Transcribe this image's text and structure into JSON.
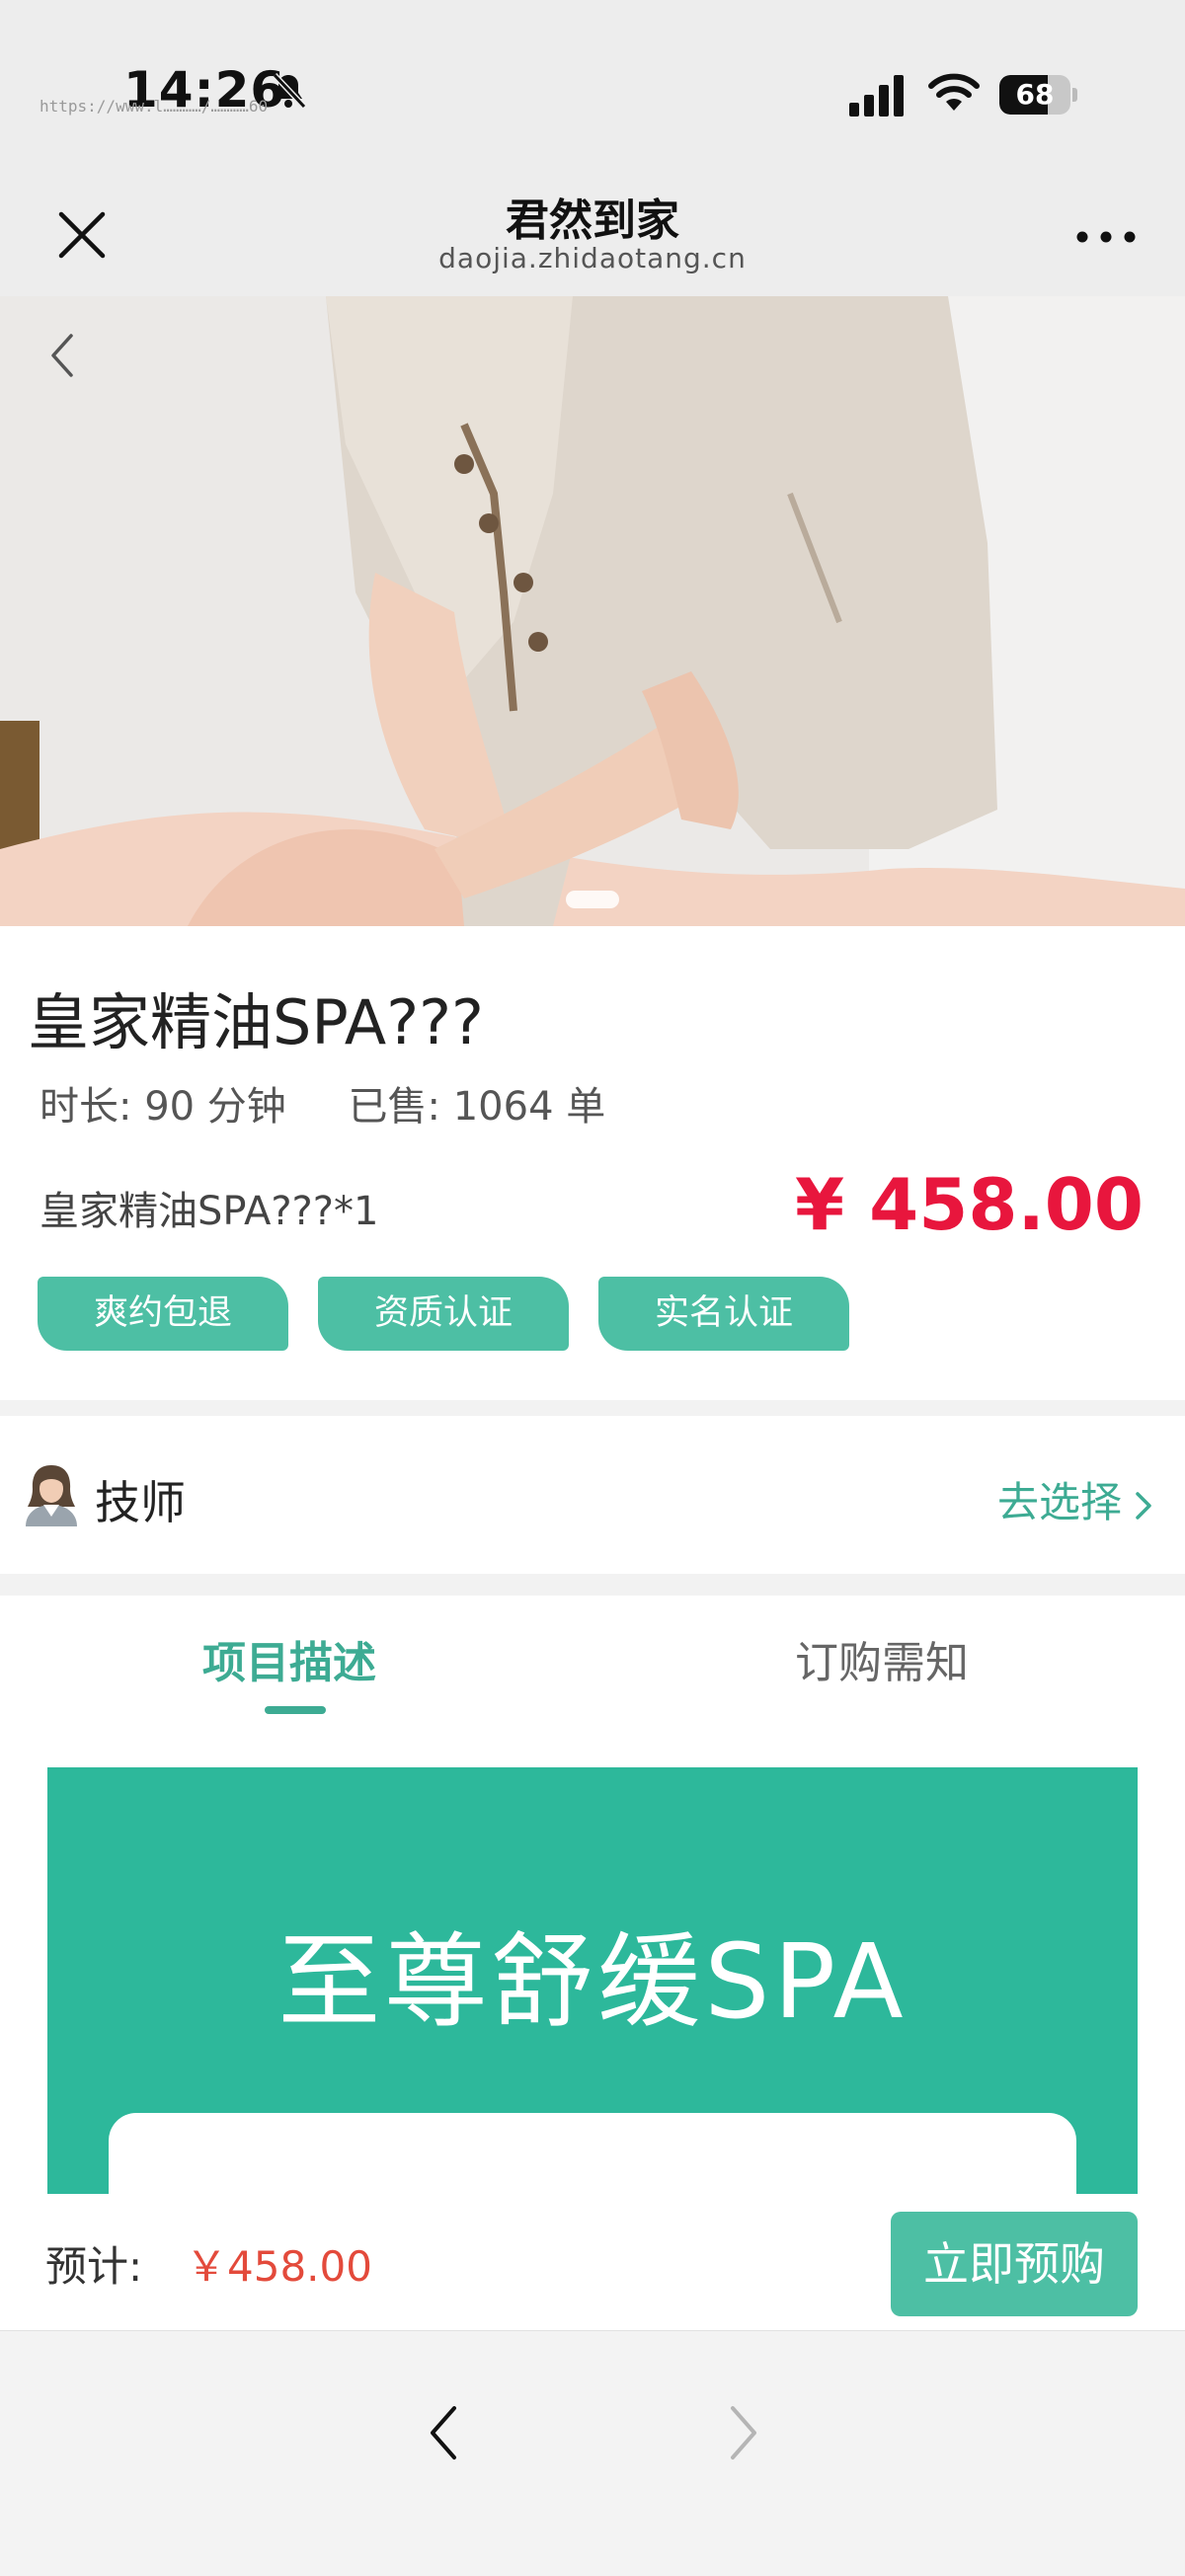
{
  "status_bar": {
    "time": "14:26",
    "battery": "68",
    "battery_level": 0.68,
    "watermark": "https://www.l…………/…………60"
  },
  "nav": {
    "title": "君然到家",
    "url": "daojia.zhidaotang.cn"
  },
  "product": {
    "name": "皇家精油SPA???",
    "duration": "时长: 90 分钟",
    "sold": "已售: 1064 单",
    "sku": "皇家精油SPA???*1",
    "price": "¥ 458.00",
    "tags": [
      "爽约包退",
      "资质认证",
      "实名认证"
    ]
  },
  "technician": {
    "label": "技师",
    "action": "去选择"
  },
  "tabs": {
    "description": "项目描述",
    "notice": "订购需知"
  },
  "banner": {
    "title": "至尊舒缓SPA"
  },
  "purchase": {
    "estimate_label": "预计:",
    "estimate_price": "￥458.00",
    "buy_label": "立即预购"
  },
  "colors": {
    "accent": "#4dbfa4",
    "price_red": "#e8163d",
    "banner_green": "#2db89b"
  },
  "icons": [
    "bell-off-icon",
    "signal-icon",
    "wifi-icon",
    "battery-icon",
    "close-icon",
    "more-icon",
    "back-arrow-icon",
    "technician-avatar-icon",
    "chevron-right-icon",
    "nav-back-icon",
    "nav-forward-icon"
  ]
}
